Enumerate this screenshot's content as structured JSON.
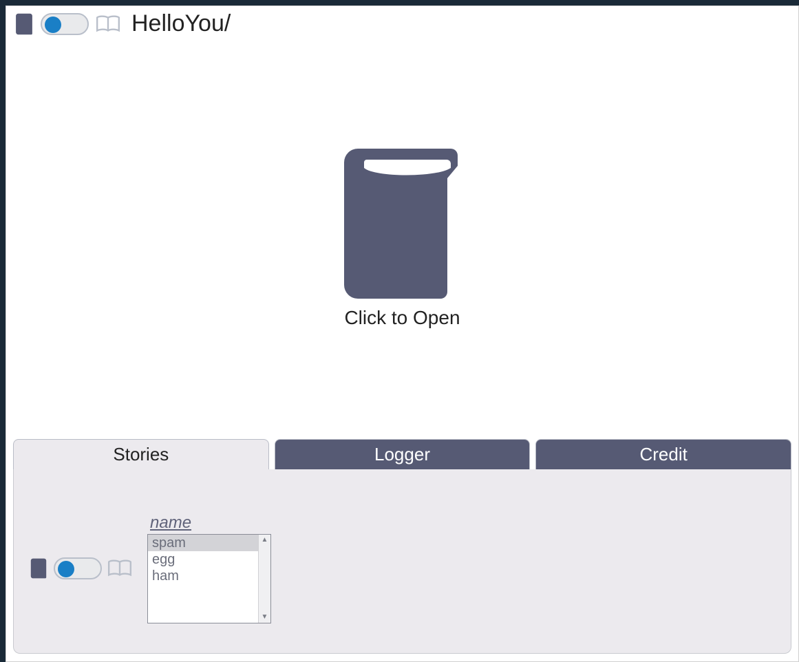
{
  "header": {
    "title": "HelloYou/",
    "toggle_state": "left",
    "icons": {
      "closed_book": "book-closed-icon",
      "open_book": "book-open-icon"
    }
  },
  "main": {
    "open_label": "Click to Open"
  },
  "tabs": [
    {
      "label": "Stories",
      "active": true
    },
    {
      "label": "Logger",
      "active": false
    },
    {
      "label": "Credit",
      "active": false
    }
  ],
  "stories_panel": {
    "toggle_state": "left",
    "list_header": "name",
    "items": [
      {
        "label": "spam",
        "selected": true
      },
      {
        "label": "egg",
        "selected": false
      },
      {
        "label": "ham",
        "selected": false
      }
    ]
  },
  "colors": {
    "slate": "#565a74",
    "toggle_knob": "#1a7fc6",
    "panel_bg": "#eceaee"
  }
}
